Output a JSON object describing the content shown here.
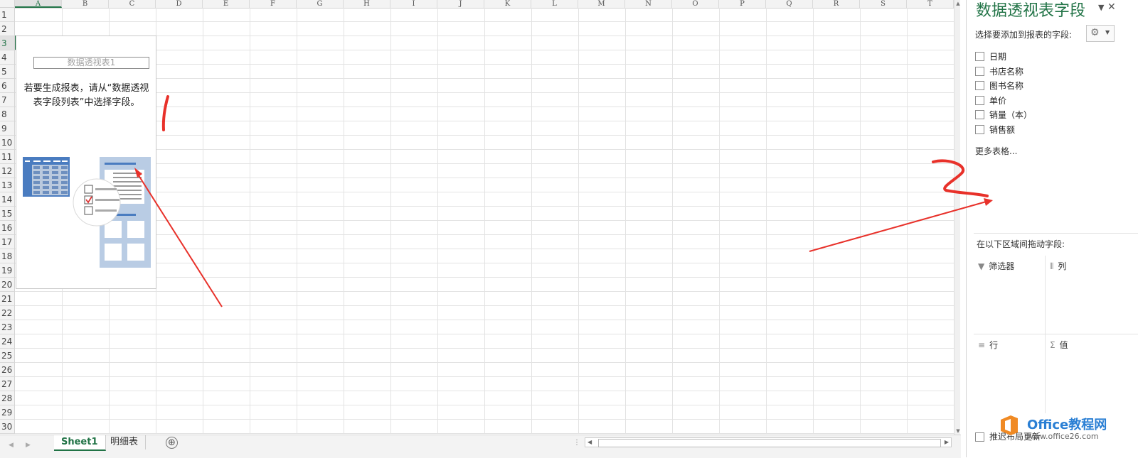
{
  "columns": [
    "A",
    "B",
    "C",
    "D",
    "E",
    "F",
    "G",
    "H",
    "I",
    "J",
    "K",
    "L",
    "M",
    "N",
    "O",
    "P",
    "Q",
    "R",
    "S",
    "T"
  ],
  "rows": [
    "1",
    "2",
    "3",
    "4",
    "5",
    "6",
    "7",
    "8",
    "9",
    "10",
    "11",
    "12",
    "13",
    "14",
    "15",
    "16",
    "17",
    "18",
    "19",
    "20",
    "21",
    "22",
    "23",
    "24",
    "25",
    "26",
    "27",
    "28",
    "29",
    "30"
  ],
  "selected_column": "A",
  "selected_row": "3",
  "pivot": {
    "name": "数据透视表1",
    "hint": "若要生成报表，请从“数据透视表字段列表”中选择字段。"
  },
  "sheet_tabs": [
    "Sheet1",
    "明细表"
  ],
  "active_tab": "Sheet1",
  "add_sheet_icon": "⊕",
  "panel": {
    "title": "数据透视表字段",
    "subtitle": "选择要添加到报表的字段:",
    "fields": [
      "日期",
      "书店名称",
      "图书名称",
      "单价",
      "销量（本）",
      "销售额"
    ],
    "more_tables": "更多表格...",
    "drag_label": "在以下区域间拖动字段:",
    "areas": {
      "filters": "筛选器",
      "columns": "列",
      "rows": "行",
      "values": "值"
    },
    "defer_update": "推迟布局更新"
  },
  "watermark": {
    "name": "Office教程网",
    "url": "www.office26.com"
  },
  "colors": {
    "accent": "#217346",
    "annotation": "#e8312a",
    "watermark_blue": "#2a7fd4",
    "watermark_orange": "#f08a24"
  }
}
